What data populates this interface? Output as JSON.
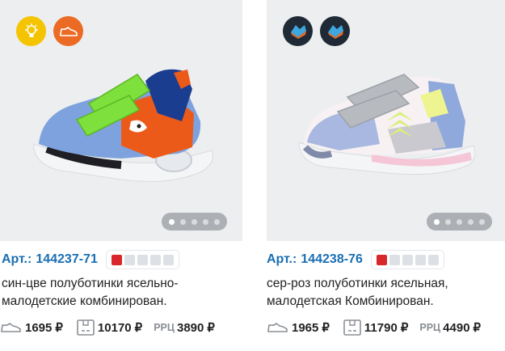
{
  "products": [
    {
      "badges": [
        "led-light-icon",
        "sneaker-icon"
      ],
      "gallery": {
        "total": 5,
        "active": 0
      },
      "art_label": "Арт.:",
      "art_number": "144237-71",
      "stock_level": 1,
      "stock_max": 5,
      "name_line1": "син-цве полуботинки ясельно-",
      "name_line2": "малодетские комбинирован.",
      "price_pair": "1695",
      "price_box": "10170",
      "rrc_label": "РРЦ",
      "price_rrc": "3890",
      "currency": "₽"
    },
    {
      "badges": [
        "season-icon",
        "season-icon"
      ],
      "gallery": {
        "total": 5,
        "active": 0
      },
      "art_label": "Арт.:",
      "art_number": "144238-76",
      "stock_level": 1,
      "stock_max": 5,
      "name_line1": "сер-роз полуботинки ясельная,",
      "name_line2": "малодетская Комбинирован.",
      "price_pair": "1965",
      "price_box": "11790",
      "rrc_label": "РРЦ",
      "price_rrc": "4490",
      "currency": "₽"
    }
  ],
  "colors": {
    "accent": "#1a6fb3",
    "stock_on": "#d8262a",
    "badge_yellow": "#f5c400",
    "badge_orange": "#ec6b24",
    "badge_dark": "#1f2a36"
  }
}
